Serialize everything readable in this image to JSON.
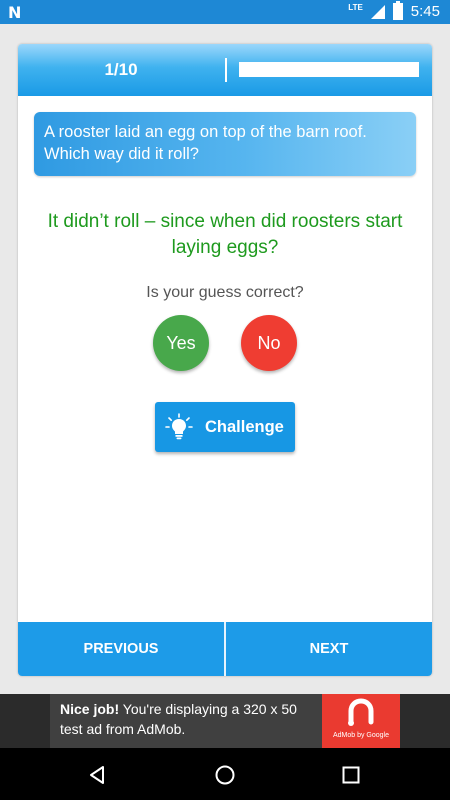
{
  "status_bar": {
    "notification_icon": "N",
    "network": "LTE",
    "time": "5:45"
  },
  "quiz": {
    "counter": "1/10",
    "progress": 0.1,
    "question": "A rooster laid an egg on top of the barn roof. Which way did it roll?",
    "answer": "It didn’t roll – since when did roosters start laying eggs?",
    "guess_prompt": "Is your guess correct?",
    "yes_label": "Yes",
    "no_label": "No",
    "challenge_label": "Challenge"
  },
  "footer": {
    "previous_label": "PREVIOUS",
    "next_label": "NEXT"
  },
  "ad": {
    "headline": "Nice job!",
    "body": "You're displaying a 320 x 50 test ad from AdMob.",
    "logo_text": "AdMob by Google"
  },
  "colors": {
    "accent_blue": "#1d9be8",
    "correct_green": "#48a84b",
    "wrong_red": "#ef3d32",
    "answer_green": "#1e9a1e"
  },
  "icons": [
    "lightbulb-icon",
    "back-icon",
    "home-icon",
    "recents-icon",
    "signal-icon",
    "battery-icon",
    "admob-logo-icon"
  ]
}
